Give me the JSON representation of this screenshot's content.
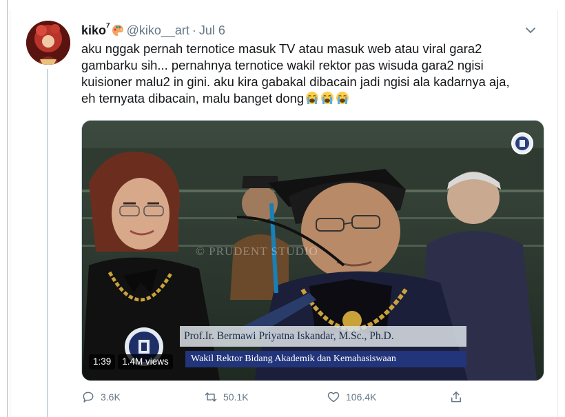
{
  "tweet": {
    "display_name": "kiko",
    "name_superscript": "7",
    "name_emoji": "artist-palette-emoji",
    "handle": "@kiko__art",
    "separator": "·",
    "date": "Jul 6",
    "text": "aku nggak pernah ternotice masuk TV atau masuk web atau viral gara2\ngambarku sih... pernahnya ternotice wakil rektor pas wisuda gara2 ngisi\nkuisioner malu2 in gini. aku kira gabakal dibacain jadi ngisi ala kadarnya aja,\neh ternyata dibacain, malu banget dong",
    "trailing_emojis": [
      "loudly-crying-face-emoji",
      "loudly-crying-face-emoji",
      "loudly-crying-face-emoji"
    ]
  },
  "video": {
    "duration": "1:39",
    "views": "1.4M views",
    "watermark": "© PRUDENT STUDIO",
    "caption_name": "Prof.Ir. Bermawi Priyatna Iskandar, M.Sc., Ph.D.",
    "caption_title": "Wakil Rektor Bidang Akademik dan Kemahasiswaan"
  },
  "actions": {
    "replies": "3.6K",
    "retweets": "50.1K",
    "likes": "106.4K"
  },
  "colors": {
    "text_primary": "#14171a",
    "text_secondary": "#657786",
    "border": "#e6ecf0",
    "caption_band": "#22347a"
  }
}
